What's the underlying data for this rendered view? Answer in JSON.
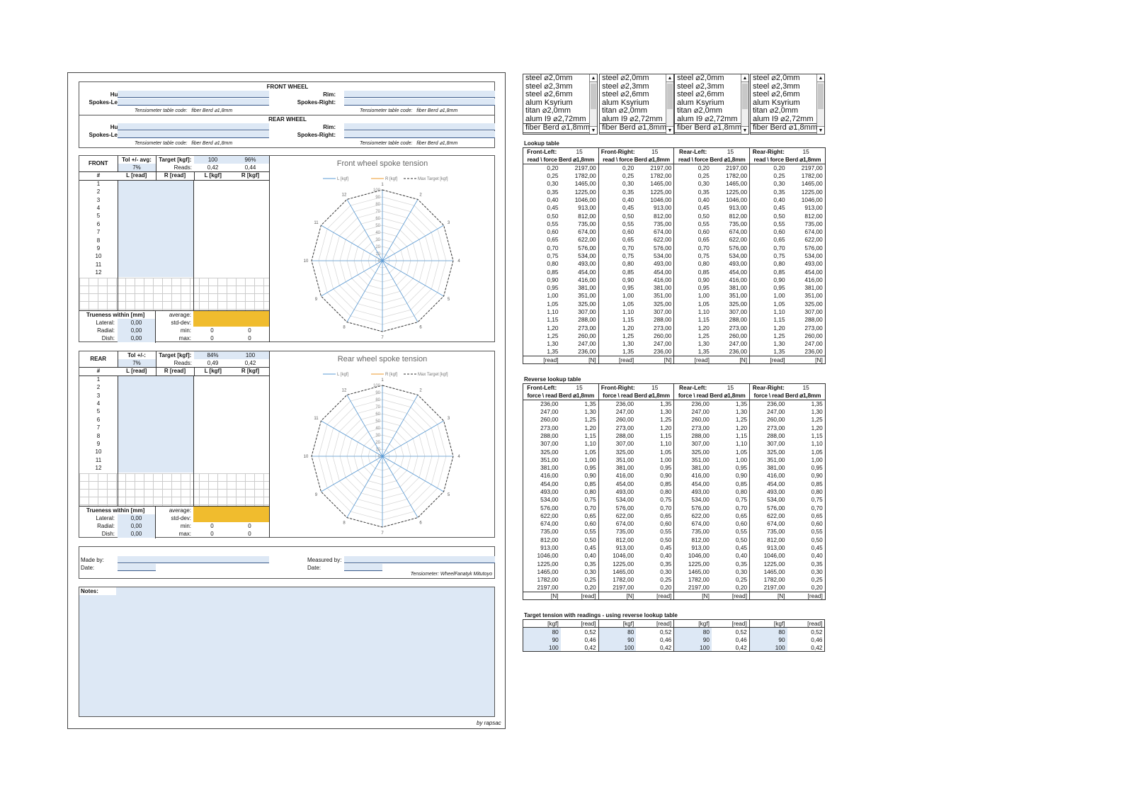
{
  "header": {
    "front_wheel": "FRONT WHEEL",
    "rear_wheel": "REAR WHEEL",
    "hub": "Hub:",
    "rim": "Rim:",
    "spokes_left": "Spokes-Left:",
    "spokes_right": "Spokes-Right:",
    "tens_code": "Tensiometer table code:   fiber Berd ⌀1,8mm"
  },
  "front": {
    "label": "FRONT",
    "tol_label": "Tol +/- avg:",
    "tol_value": "7%",
    "target_label": "Target [kgf]:",
    "target_value": "100",
    "target_pct": "96%",
    "reads_label": "Reads:",
    "reads_l": "0,42",
    "reads_r": "0,44",
    "chart_title": "Front wheel spoke tension"
  },
  "rear": {
    "label": "REAR",
    "tol_label": "Tol +/-:",
    "tol_value": "7%",
    "target_label": "Target [kgf]:",
    "target_value": "84%",
    "target_pct": "100",
    "reads_label": "Reads:",
    "reads_l": "0,49",
    "reads_r": "0,42",
    "chart_title": "Rear wheel spoke tension"
  },
  "spoke_cols": {
    "num": "#",
    "l_read": "L [read]",
    "r_read": "R [read]",
    "l_kgf": "L [kgf]",
    "r_kgf": "R [kgf]"
  },
  "spoke_numbers": [
    "1",
    "2",
    "3",
    "4",
    "5",
    "6",
    "7",
    "8",
    "9",
    "10",
    "11",
    "12"
  ],
  "trueness": {
    "title": "Trueness within [mm]",
    "lateral": "Lateral:",
    "radial": "Radial:",
    "dish": "Dish:",
    "value": "0,00",
    "average": "average:",
    "stddev": "std-dev:",
    "min": "min:",
    "max": "max:",
    "zero": "0"
  },
  "chart_data": [
    {
      "type": "radar",
      "title": "Front wheel spoke tension",
      "categories": [
        "1",
        "2",
        "3",
        "4",
        "5",
        "6",
        "7",
        "8",
        "9",
        "10",
        "11",
        "12"
      ],
      "radial_ticks": [
        "0",
        "10",
        "20",
        "30",
        "40",
        "50",
        "60",
        "70",
        "80",
        "90",
        "100"
      ],
      "rlim": [
        0,
        100
      ],
      "series": [
        {
          "name": "L [kgf]",
          "values": [],
          "color": "#5b9bd5"
        },
        {
          "name": "R [kgf]",
          "values": [],
          "color": "#ed9a2b"
        },
        {
          "name": "Max Target [kgf]",
          "values": [
            100,
            100,
            100,
            100,
            100,
            100,
            100,
            100,
            100,
            100,
            100,
            100
          ],
          "color": "#333333",
          "dashed": true
        }
      ],
      "legend": "top"
    },
    {
      "type": "radar",
      "title": "Rear wheel spoke tension",
      "categories": [
        "1",
        "2",
        "3",
        "4",
        "5",
        "6",
        "7",
        "8",
        "9",
        "10",
        "11",
        "12"
      ],
      "radial_ticks": [
        "0",
        "10",
        "20",
        "30",
        "40",
        "50",
        "60",
        "70",
        "80",
        "90",
        "100"
      ],
      "rlim": [
        0,
        100
      ],
      "series": [
        {
          "name": "L [kgf]",
          "values": [],
          "color": "#5b9bd5"
        },
        {
          "name": "R [kgf]",
          "values": [],
          "color": "#ed9a2b"
        },
        {
          "name": "Max Target [kgf]",
          "values": [
            100,
            100,
            100,
            100,
            100,
            100,
            100,
            100,
            100,
            100,
            100,
            100
          ],
          "color": "#333333",
          "dashed": true
        }
      ],
      "legend": "top"
    }
  ],
  "footer": {
    "made_by": "Made by:",
    "date": "Date:",
    "measured_by": "Measured by:",
    "tensiometer": "Tensiometer: WheelFanatyk Mitutoyo",
    "notes": "Notes:",
    "by": "by rapsac"
  },
  "listboxes": {
    "items": [
      "steel ⌀2,0mm",
      "steel ⌀2,3mm",
      "steel ⌀2,6mm",
      "alum Ksyrium",
      "titan ⌀2,0mm",
      "alum I9 ⌀2,72mm",
      "fiber Berd ⌀1,8mm"
    ],
    "up": "▲",
    "down": "▼"
  },
  "lookup": {
    "title": "Lookup table",
    "groups": [
      "Front-Left:",
      "Front-Right:",
      "Rear-Left:",
      "Rear-Right:"
    ],
    "count": "15",
    "subhdr": "read \\ force Berd ⌀1,8mm",
    "reads": [
      "0,20",
      "0,25",
      "0,30",
      "0,35",
      "0,40",
      "0,45",
      "0,50",
      "0,55",
      "0,60",
      "0,65",
      "0,70",
      "0,75",
      "0,80",
      "0,85",
      "0,90",
      "0,95",
      "1,00",
      "1,05",
      "1,10",
      "1,15",
      "1,20",
      "1,25",
      "1,30",
      "1,35"
    ],
    "forces": [
      "2197,00",
      "1782,00",
      "1465,00",
      "1225,00",
      "1046,00",
      "913,00",
      "812,00",
      "735,00",
      "674,00",
      "622,00",
      "576,00",
      "534,00",
      "493,00",
      "454,00",
      "416,00",
      "381,00",
      "351,00",
      "325,00",
      "307,00",
      "288,00",
      "273,00",
      "260,00",
      "247,00",
      "236,00"
    ],
    "reads_rl": [
      "0,20",
      "0,25",
      "0,30",
      "0,35",
      "0,40",
      "0,45",
      "0,50",
      "0,55",
      "0,60",
      "0,65",
      "0,70",
      "0,75",
      "0,80",
      "0,85",
      "0,90",
      "0,95",
      "1,00",
      "1,05",
      "1,10",
      "1,15",
      "1,20",
      "1,25",
      "1,30",
      "1,35"
    ],
    "reads_rr": [
      "0,20",
      "0,25",
      "0,30",
      "0,35",
      "0,40",
      "0,45",
      "0,50",
      "0,55",
      "0,60",
      "0,65",
      "0,70",
      "0,75",
      "0,80",
      "0,85",
      "0,90",
      "0,95",
      "1,00",
      "1,05",
      "1,10",
      "1,15",
      "1,20",
      "1,25",
      "1,30",
      "1,35"
    ],
    "unit_read": "[read]",
    "unit_n": "[N]"
  },
  "reverse": {
    "title": "Reverse lookup table",
    "subhdr": "force \\ read Berd ⌀1,8mm",
    "forces": [
      "236,00",
      "247,00",
      "260,00",
      "273,00",
      "288,00",
      "307,00",
      "325,00",
      "351,00",
      "381,00",
      "416,00",
      "454,00",
      "493,00",
      "534,00",
      "576,00",
      "622,00",
      "674,00",
      "735,00",
      "812,00",
      "913,00",
      "1046,00",
      "1225,00",
      "1465,00",
      "1782,00",
      "2197,00"
    ],
    "reads": [
      "1,35",
      "1,30",
      "1,25",
      "1,20",
      "1,15",
      "1,10",
      "1,05",
      "1,00",
      "0,95",
      "0,90",
      "0,85",
      "0,80",
      "0,75",
      "0,70",
      "0,65",
      "0,60",
      "0,55",
      "0,50",
      "0,45",
      "0,40",
      "0,35",
      "0,30",
      "0,25",
      "0,20"
    ]
  },
  "target": {
    "title": "Target tension with readings - using reverse lookup table",
    "unit_kgf": "[kgf]",
    "unit_read": "[read]",
    "kgf": [
      "80",
      "90",
      "100"
    ],
    "reads": [
      "0,52",
      "0,46",
      "0,42"
    ]
  }
}
